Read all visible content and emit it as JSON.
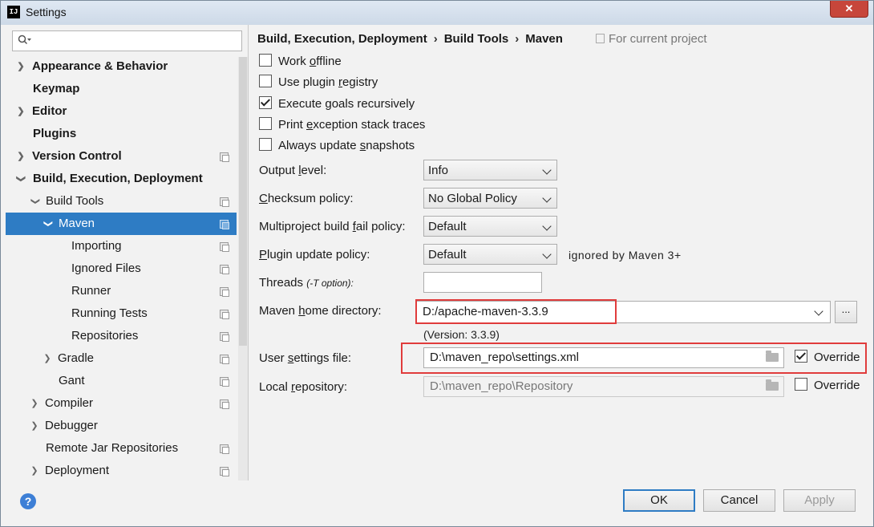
{
  "window": {
    "title": "Settings",
    "app_icon": "IJ",
    "close_glyph": "✕"
  },
  "search": {
    "placeholder": ""
  },
  "sidebar": {
    "items": [
      {
        "label": "Appearance & Behavior"
      },
      {
        "label": "Keymap"
      },
      {
        "label": "Editor"
      },
      {
        "label": "Plugins"
      },
      {
        "label": "Version Control"
      },
      {
        "label": "Build, Execution, Deployment"
      },
      {
        "label": "Build Tools"
      },
      {
        "label": "Maven"
      },
      {
        "label": "Importing"
      },
      {
        "label": "Ignored Files"
      },
      {
        "label": "Runner"
      },
      {
        "label": "Running Tests"
      },
      {
        "label": "Repositories"
      },
      {
        "label": "Gradle"
      },
      {
        "label": "Gant"
      },
      {
        "label": "Compiler"
      },
      {
        "label": "Debugger"
      },
      {
        "label": "Remote Jar Repositories"
      },
      {
        "label": "Deployment"
      }
    ]
  },
  "breadcrumb": {
    "part1": "Build, Execution, Deployment",
    "part2": "Build Tools",
    "part3": "Maven",
    "separator": "›"
  },
  "scope_note": "For current project",
  "checkboxes": {
    "work_offline": {
      "pre": "Work ",
      "key": "o",
      "post": "ffline"
    },
    "plugin_registry": {
      "pre": "Use plugin ",
      "key": "r",
      "post": "egistry"
    },
    "execute_goals": {
      "pre": "Execute ",
      "key": "g",
      "post": "oals recursively"
    },
    "print_exception": {
      "pre": "Print ",
      "key": "e",
      "post": "xception stack traces"
    },
    "always_update": {
      "pre": "Always update ",
      "key": "s",
      "post": "napshots"
    }
  },
  "output_level": {
    "pre": "Output ",
    "key": "l",
    "post": "evel:",
    "value": "Info"
  },
  "checksum_policy": {
    "pre": "",
    "key": "C",
    "post": "hecksum policy:",
    "value": "No Global Policy"
  },
  "multiproject": {
    "pre": "Multiproject build ",
    "key": "f",
    "post": "ail policy:",
    "value": "Default"
  },
  "plugin_update": {
    "pre": "",
    "key": "P",
    "post": "lugin update policy:",
    "value": "Default",
    "hint": "ignored by Maven 3+"
  },
  "threads": {
    "label": "Threads",
    "hint": "(-T option):",
    "value": ""
  },
  "maven_home": {
    "pre": "Maven ",
    "key": "h",
    "post": "ome directory:",
    "value": "D:/apache-maven-3.3.9",
    "version": "(Version: 3.3.9)",
    "browse": "..."
  },
  "user_settings": {
    "pre": "User ",
    "key": "s",
    "post": "ettings file:",
    "value": "D:\\maven_repo\\settings.xml",
    "override": "Override"
  },
  "local_repo": {
    "pre": "Local ",
    "key": "r",
    "post": "epository:",
    "value": "D:\\maven_repo\\Repository",
    "override": "Override"
  },
  "footer": {
    "help": "?",
    "ok": "OK",
    "cancel": "Cancel",
    "apply": "Apply"
  },
  "colors": {
    "selection": "#2e7cc4",
    "highlight_box": "#e03c3c"
  }
}
